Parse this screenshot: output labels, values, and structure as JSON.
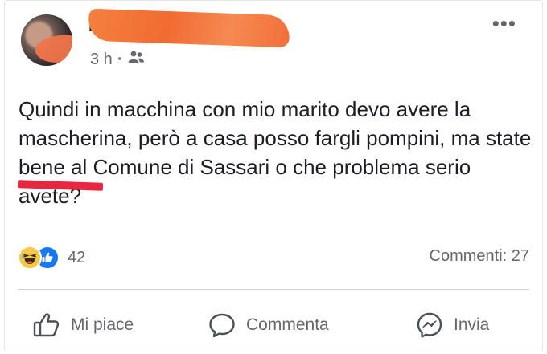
{
  "post": {
    "author_name": "Fl",
    "time": "3 h",
    "separator": "·",
    "audience_icon": "friends-icon",
    "more_label": "•••",
    "text": "Quindi in macchina con mio marito devo avere la mascherina, però a casa posso fargli pompini, ma state bene al Comune di Sassari o che problema serio avete?"
  },
  "reactions": {
    "icons": [
      "haha-icon",
      "like-icon"
    ],
    "count": "42"
  },
  "comments": {
    "label": "Commenti: 27"
  },
  "actions": {
    "like_label": "Mi piace",
    "comment_label": "Commenta",
    "share_label": "Invia"
  },
  "colors": {
    "like_blue": "#1877f2",
    "haha_yellow": "#f7c845",
    "redaction_orange": "#f26b32",
    "redaction_red": "#e8263f",
    "secondary_text": "#65676b"
  }
}
